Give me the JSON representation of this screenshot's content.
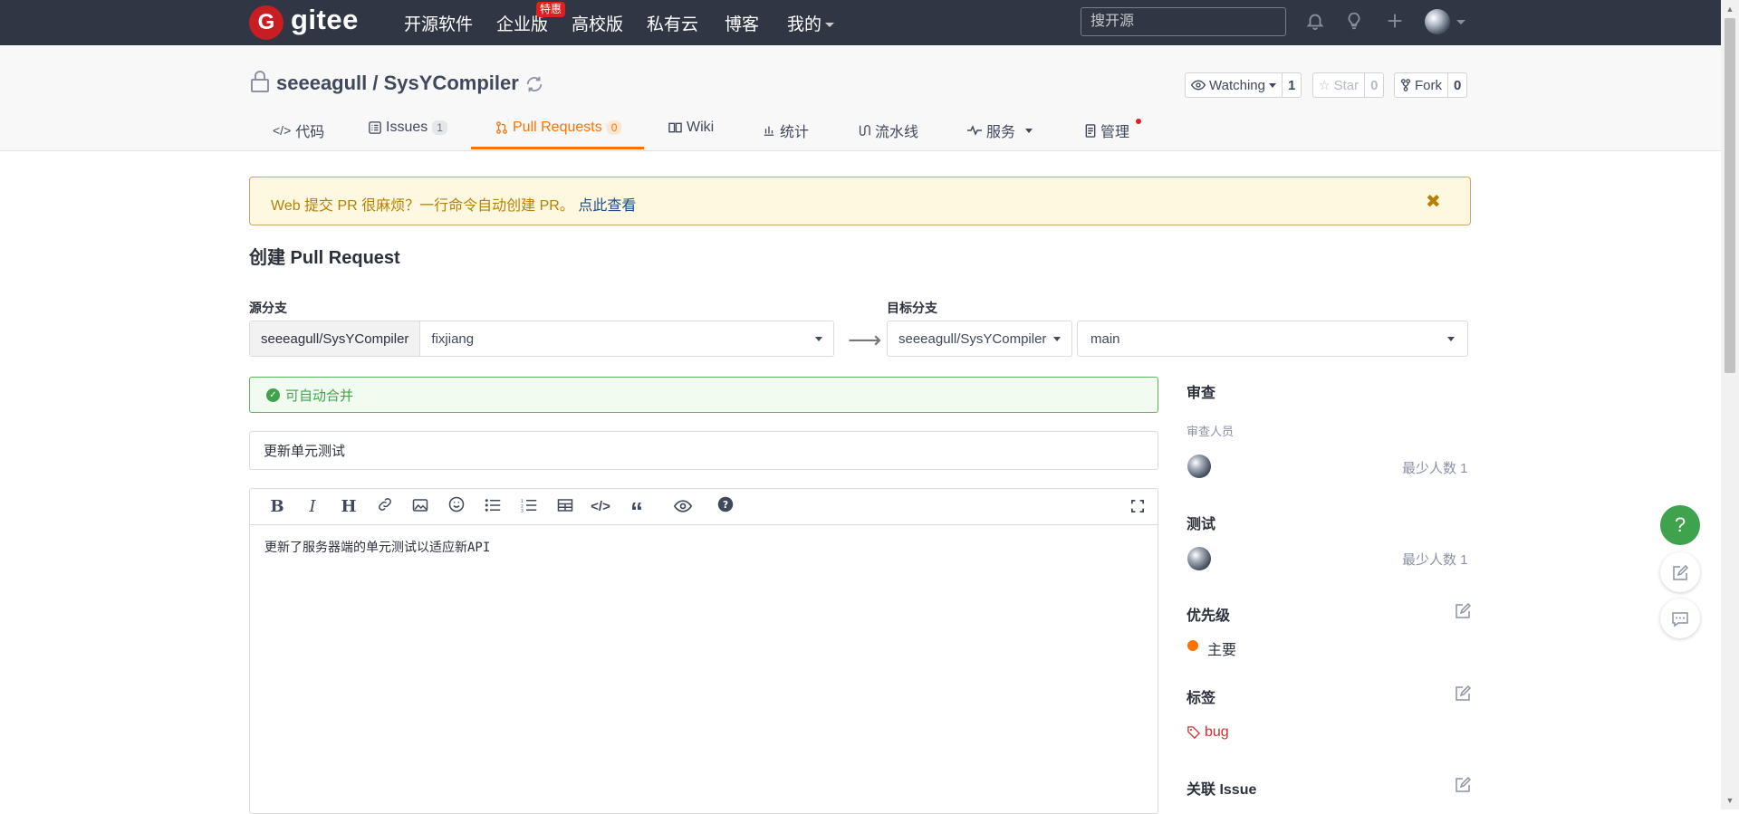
{
  "topnav": {
    "logo_text": "gitee",
    "items": [
      {
        "label": "开源软件"
      },
      {
        "label": "企业版"
      },
      {
        "label": "高校版"
      },
      {
        "label": "私有云"
      },
      {
        "label": "博客"
      },
      {
        "label": "我的"
      }
    ],
    "hot_badge": "特惠",
    "search_placeholder": "搜开源"
  },
  "repo": {
    "title": "seeeagull / SysYCompiler",
    "watching_label": "Watching",
    "watching_count": "1",
    "star_label": "Star",
    "star_count": "0",
    "fork_label": "Fork",
    "fork_count": "0"
  },
  "tabs": [
    {
      "label": "代码"
    },
    {
      "label": "Issues",
      "count": "1"
    },
    {
      "label": "Pull Requests",
      "count": "0"
    },
    {
      "label": "Wiki"
    },
    {
      "label": "统计"
    },
    {
      "label": "流水线"
    },
    {
      "label": "服务"
    },
    {
      "label": "管理"
    }
  ],
  "notice": {
    "text": "Web 提交 PR 很麻烦？一行命令自动创建 PR。",
    "link": "点此查看"
  },
  "form": {
    "page_title": "创建 Pull Request",
    "source_label": "源分支",
    "source_repo": "seeeagull/SysYCompiler",
    "source_branch": "fixjiang",
    "target_label": "目标分支",
    "target_repo": "seeeagull/SysYCompiler",
    "target_branch": "main",
    "merge_status": "可自动合并",
    "title_value": "更新单元测试",
    "body_text": "更新了服务器端的单元测试以适应新API"
  },
  "sidebar": {
    "review_heading": "审查",
    "reviewer_label": "审查人员",
    "reviewer_min": "最少人数 1",
    "test_heading": "测试",
    "tester_min": "最少人数 1",
    "priority_heading": "优先级",
    "priority_value": "主要",
    "labels_heading": "标签",
    "label_value": "bug",
    "issue_heading": "关联 Issue"
  },
  "colors": {
    "nav_bg": "#303643",
    "accent": "#fe7300",
    "brand_red": "#c71d23",
    "success": "#3fa34d",
    "label_red": "#c8342c"
  },
  "icons": [
    "lock-icon",
    "sync-icon",
    "bell-icon",
    "lightbulb-icon",
    "plus-icon",
    "eye-icon",
    "star-icon",
    "fork-icon",
    "close-icon",
    "check-circle-icon",
    "tag-icon",
    "edit-icon",
    "help-icon",
    "feedback-icon",
    "chat-icon",
    "fullscreen-icon"
  ]
}
